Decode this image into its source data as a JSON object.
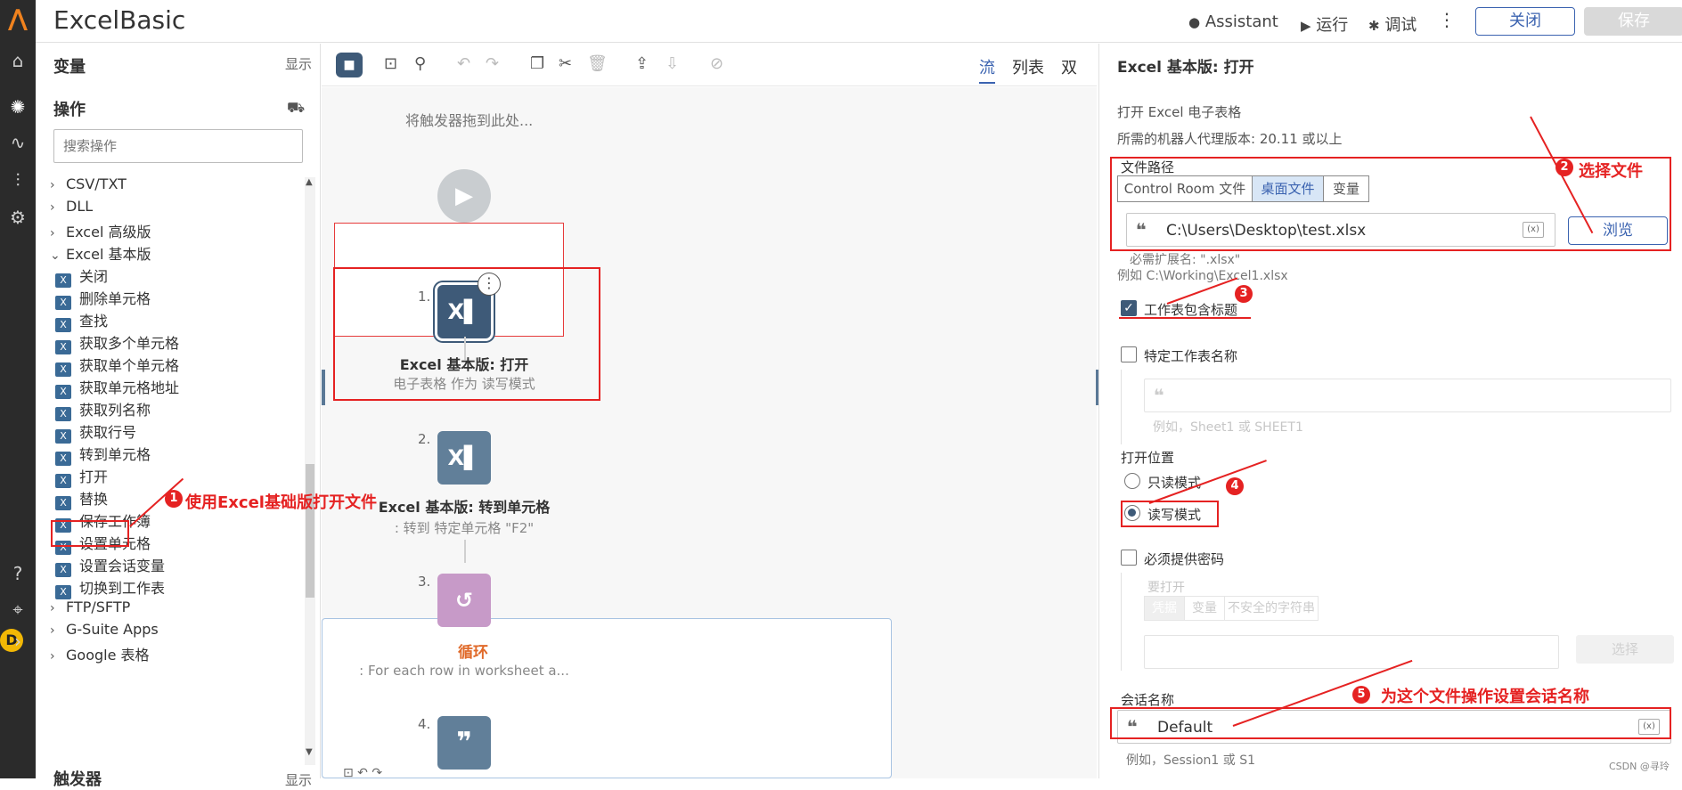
{
  "app": {
    "title": "ExcelBasic"
  },
  "topbar": {
    "assistant": "Assistant",
    "run": "运行",
    "debug": "调试",
    "more": "⋮",
    "close": "关闭",
    "save": "保存"
  },
  "left": {
    "variables": "变量",
    "show": "显示",
    "actions": "操作",
    "search_placeholder": "搜索操作",
    "tree": [
      {
        "label": "CSV/TXT",
        "chev": "›"
      },
      {
        "label": "DLL",
        "chev": "›"
      },
      {
        "label": "Excel 高级版",
        "chev": "›"
      },
      {
        "label": "Excel 基本版",
        "chev": "⌄"
      },
      {
        "label": "关闭"
      },
      {
        "label": "删除单元格"
      },
      {
        "label": "查找"
      },
      {
        "label": "获取多个单元格"
      },
      {
        "label": "获取单个单元格"
      },
      {
        "label": "获取单元格地址"
      },
      {
        "label": "获取列名称"
      },
      {
        "label": "获取行号"
      },
      {
        "label": "转到单元格"
      },
      {
        "label": "打开"
      },
      {
        "label": "替换"
      },
      {
        "label": "保存工作簿"
      },
      {
        "label": "设置单元格"
      },
      {
        "label": "设置会话变量"
      },
      {
        "label": "切换到工作表"
      },
      {
        "label": "FTP/SFTP",
        "chev": "›"
      },
      {
        "label": "G-Suite Apps",
        "chev": "›"
      },
      {
        "label": "Google 表格",
        "chev": "›"
      }
    ],
    "bottom_head": "触发器",
    "bottom_show": "显示",
    "avatar_letter": "D"
  },
  "canvas": {
    "view_tabs": [
      "流",
      "列表",
      "双"
    ],
    "hint": "将触发器拖到此处...",
    "start": "开始",
    "nodes": [
      {
        "num": "1.",
        "title": "Excel 基本版: 打开",
        "sub": "电子表格 作为 读写模式"
      },
      {
        "num": "2.",
        "title": "Excel 基本版: 转到单元格",
        "sub": ": 转到 特定单元格 \"F2\""
      },
      {
        "num": "3.",
        "title": "循环",
        "sub": ": For each row in worksheet a..."
      },
      {
        "num": "4.",
        "title": "",
        "sub": ""
      }
    ]
  },
  "right": {
    "title": "Excel 基本版: 打开",
    "desc": "打开 Excel 电子表格",
    "version": "所需的机器人代理版本: 20.11 或以上",
    "file_path_label": "文件路径",
    "seg": [
      "Control Room 文件",
      "桌面文件",
      "变量"
    ],
    "file_path_value": "C:\\Users\\Desktop\\test.xlsx",
    "browse": "浏览",
    "ext_hint": "必需扩展名: \".xlsx\"",
    "example": "例如 C:\\Working\\Excel1.xlsx",
    "contains_header": "工作表包含标题",
    "specific_sheet": "特定工作表名称",
    "sheet_example": "例如，Sheet1 或 SHEET1",
    "open_position": "打开位置",
    "readonly": "只读模式",
    "readwrite": "读写模式",
    "password_required": "必须提供密码",
    "to_open": "要打开",
    "pwd_seg": [
      "凭据",
      "变量",
      "不安全的字符串"
    ],
    "choose": "选择",
    "session_label": "会话名称",
    "session_value": "Default",
    "session_example": "例如，Session1 或 S1",
    "var_icon": "(x)"
  },
  "annotations": {
    "a1": "使用Excel基础版打开文件",
    "a2": "选择文件",
    "a5": "为这个文件操作设置会话名称",
    "n1": "1",
    "n2": "2",
    "n3": "3",
    "n4": "4",
    "n5": "5"
  },
  "watermark": "CSDN @寻玲",
  "colors": {
    "accent": "#3b63b0",
    "annotation": "#e52222",
    "node": "#617f99",
    "loop": "#c79ac8"
  }
}
